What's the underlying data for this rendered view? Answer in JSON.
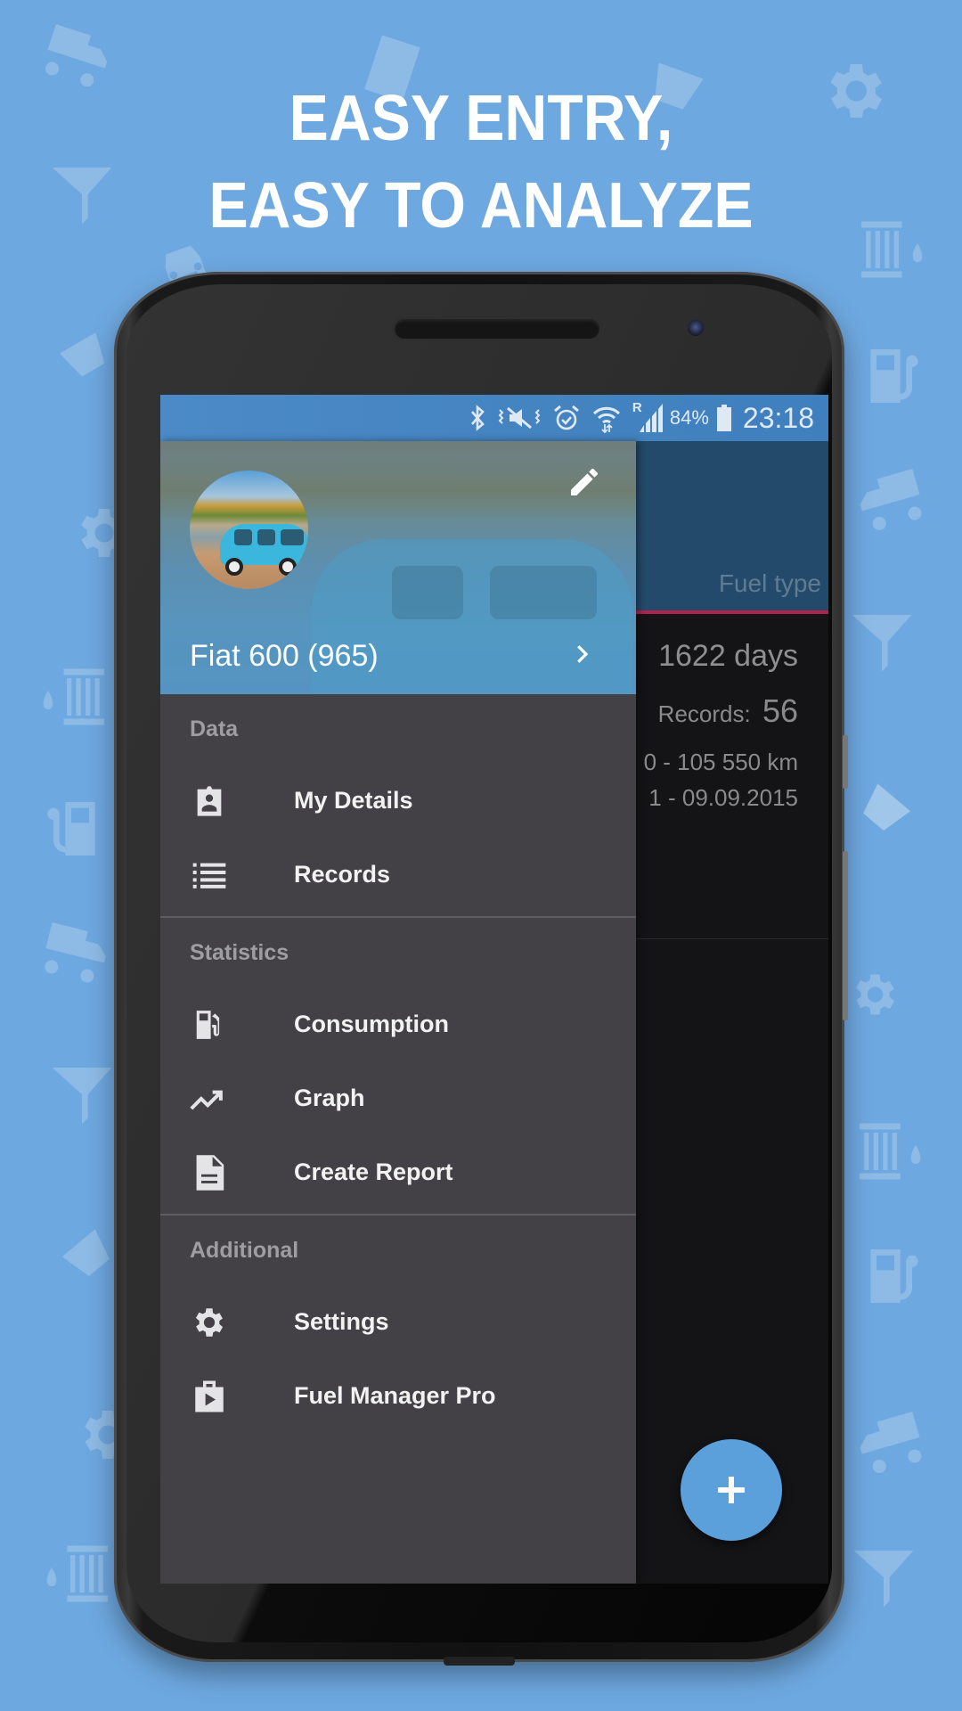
{
  "promo": {
    "headline_line1": "EASY ENTRY,",
    "headline_line2": "EASY TO ANALYZE",
    "background_color": "#6ea8e0"
  },
  "status_bar": {
    "icons": [
      "bluetooth-icon",
      "vibrate-mute-icon",
      "alarm-icon",
      "wifi-icon",
      "signal-roaming-icon",
      "battery-icon"
    ],
    "roaming_indicator": "R",
    "battery_percent": "84%",
    "time": "23:18"
  },
  "app_background": {
    "header_label": "Fuel type",
    "duration": "1622 days",
    "records_label": "Records:",
    "records_count": "56",
    "odometer_range": "0 - 105 550 km",
    "date_range": "1 - 09.09.2015",
    "accent_color": "#b3224a"
  },
  "fab": {
    "label": "+",
    "color": "#5b9fdb"
  },
  "drawer": {
    "vehicle_name": "Fiat 600 (965)",
    "edit_icon": "pencil-icon",
    "chevron_icon": "chevron-right-icon",
    "sections": [
      {
        "label": "Data",
        "items": [
          {
            "label": "My Details",
            "icon": "contact-badge-icon"
          },
          {
            "label": "Records",
            "icon": "list-icon"
          }
        ]
      },
      {
        "label": "Statistics",
        "items": [
          {
            "label": "Consumption",
            "icon": "fuel-pump-icon"
          },
          {
            "label": "Graph",
            "icon": "trending-up-icon"
          },
          {
            "label": "Create Report",
            "icon": "document-icon"
          }
        ]
      },
      {
        "label": "Additional",
        "items": [
          {
            "label": "Settings",
            "icon": "gear-icon"
          },
          {
            "label": "Fuel Manager Pro",
            "icon": "play-store-bag-icon"
          }
        ]
      }
    ]
  }
}
